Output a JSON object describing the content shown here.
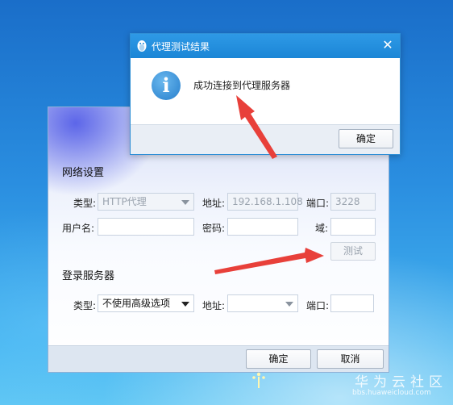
{
  "settings_dialog": {
    "network_section_title": "网络设置",
    "type_label": "类型:",
    "type_value": "HTTP代理",
    "address_label": "地址:",
    "address_value": "192.168.1.108",
    "port_label": "端口:",
    "port_value": "3228",
    "username_label": "用户名:",
    "password_label": "密码:",
    "domain_label": "域:",
    "test_button": "测试",
    "login_section_title": "登录服务器",
    "login_type_label": "类型:",
    "login_type_value": "不使用高级选项",
    "login_address_label": "地址:",
    "login_port_label": "端口:",
    "ok_button": "确定",
    "cancel_button": "取消"
  },
  "result_dialog": {
    "title": "代理测试结果",
    "close_glyph": "✕",
    "info_glyph": "i",
    "message": "成功连接到代理服务器",
    "ok_button": "确定"
  },
  "watermark": {
    "text": "华为云社区",
    "url": "bbs.huaweicloud.com"
  },
  "colors": {
    "titlebar": "#1b86d6",
    "arrow": "#e8403a",
    "footer": "#dde6f1"
  },
  "icons": {
    "app_icon": "qq-penguin-icon",
    "info_icon": "info-icon",
    "close_icon": "close-icon"
  }
}
